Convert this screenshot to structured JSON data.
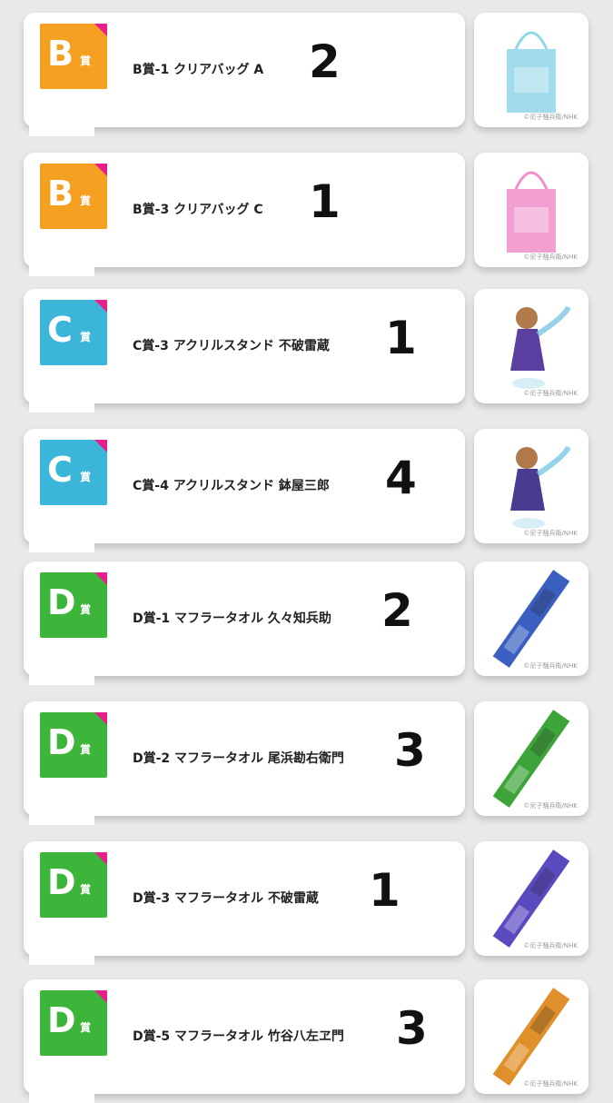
{
  "prizes": [
    {
      "badge": "B",
      "sho": "賞",
      "color": "#f5a021",
      "name": "B賞-1 クリアバッグ A",
      "count": "2",
      "thumb_icon": "clear-bag-blue-icon",
      "thumb_color": "#8fd6e8",
      "watermark": "©尼子騒兵衛/NHK"
    },
    {
      "badge": "B",
      "sho": "賞",
      "color": "#f5a021",
      "name": "B賞-3 クリアバッグ C",
      "count": "1",
      "thumb_icon": "clear-bag-pink-icon",
      "thumb_color": "#f08fc9",
      "watermark": "©尼子騒兵衛/NHK"
    },
    {
      "badge": "C",
      "sho": "賞",
      "color": "#3bb6d8",
      "name": "C賞-3 アクリルスタンド 不破雷蔵",
      "count": "1",
      "thumb_icon": "acrylic-stand-icon",
      "thumb_color": "#5a3fa0",
      "watermark": "©尼子騒兵衛/NHK"
    },
    {
      "badge": "C",
      "sho": "賞",
      "color": "#3bb6d8",
      "name": "C賞-4 アクリルスタンド 鉢屋三郎",
      "count": "4",
      "thumb_icon": "acrylic-stand-icon",
      "thumb_color": "#4a3a90",
      "watermark": "©尼子騒兵衛/NHK"
    },
    {
      "badge": "D",
      "sho": "賞",
      "color": "#3db53a",
      "name": "D賞-1 マフラータオル 久々知兵助",
      "count": "2",
      "thumb_icon": "muffler-towel-icon",
      "thumb_color": "#3a5fc0",
      "watermark": "©尼子騒兵衛/NHK"
    },
    {
      "badge": "D",
      "sho": "賞",
      "color": "#3db53a",
      "name": "D賞-2 マフラータオル 尾浜勘右衛門",
      "count": "3",
      "thumb_icon": "muffler-towel-icon",
      "thumb_color": "#3da43a",
      "watermark": "©尼子騒兵衛/NHK"
    },
    {
      "badge": "D",
      "sho": "賞",
      "color": "#3db53a",
      "name": "D賞-3 マフラータオル 不破雷蔵",
      "count": "1",
      "thumb_icon": "muffler-towel-icon",
      "thumb_color": "#5a4ac0",
      "watermark": "©尼子騒兵衛/NHK"
    },
    {
      "badge": "D",
      "sho": "賞",
      "color": "#3db53a",
      "name": "D賞-5 マフラータオル 竹谷八左ヱ門",
      "count": "3",
      "thumb_icon": "muffler-towel-icon",
      "thumb_color": "#e0902a",
      "watermark": "©尼子騒兵衛/NHK"
    }
  ]
}
